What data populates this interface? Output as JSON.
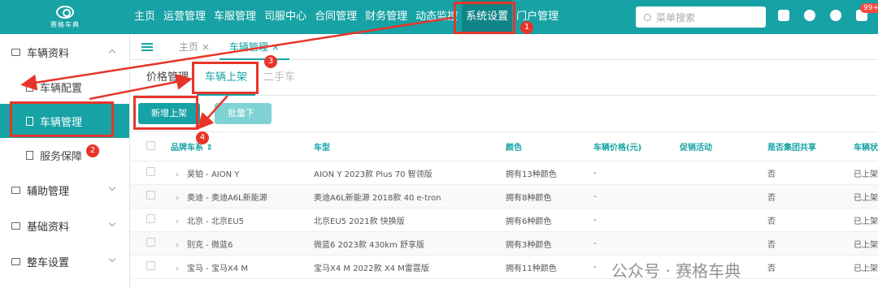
{
  "logo": {
    "brand": "赛格车典"
  },
  "nav": [
    "主页",
    "运营管理",
    "车服管理",
    "司服中心",
    "合同管理",
    "财务管理",
    "动态监控",
    "系统设置",
    "门户管理"
  ],
  "search": {
    "placeholder": "菜单搜索"
  },
  "notifications": {
    "badge": "99+"
  },
  "sidebar": {
    "vehicle_data": "车辆资料",
    "vehicle_config": "车辆配置",
    "vehicle_manage": "车辆管理",
    "service": "服务保障",
    "aux": "辅助管理",
    "base": "基础资料",
    "settings": "整车设置"
  },
  "tabs": {
    "home": "主页 ×",
    "vehicle": "车辆管理 ×"
  },
  "subtabs": {
    "price": "价格管理",
    "listing": "车辆上架",
    "used": "二手车"
  },
  "toolbar": {
    "add": "新增上架",
    "remove": "批量下架"
  },
  "table": {
    "headers": [
      "品牌车系 ⇕",
      "车型",
      "颜色",
      "车辆价格(元)",
      "促销活动",
      "是否集团共享",
      "车辆状"
    ],
    "rows": [
      [
        "昊铂 - AION Y",
        "AION Y 2023款 Plus 70 智领版",
        "拥有13种颜色",
        "-",
        "",
        "否",
        "已上架"
      ],
      [
        "奥迪 - 奥迪A6L新能源",
        "奥迪A6L新能源 2018款 40 e-tron",
        "拥有8种颜色",
        "-",
        "",
        "否",
        "已上架"
      ],
      [
        "北京 - 北京EU5",
        "北京EU5 2021款 快换版",
        "拥有6种颜色",
        "-",
        "",
        "否",
        "已上架"
      ],
      [
        "别克 - 微蓝6",
        "微蓝6 2023款 430km 舒享版",
        "拥有3种颜色",
        "-",
        "",
        "否",
        "已上架"
      ],
      [
        "宝马 - 宝马X4 M",
        "宝马X4 M 2022款 X4 M雷霆版",
        "拥有11种颜色",
        "-",
        "",
        "否",
        "已上架"
      ]
    ]
  },
  "annotations": [
    "1",
    "2",
    "3",
    "4"
  ],
  "watermark": "公众号 · 赛格车典"
}
